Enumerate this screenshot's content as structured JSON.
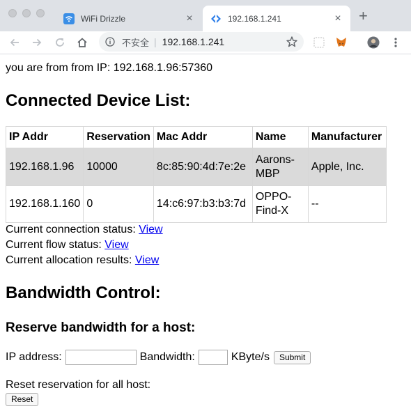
{
  "browser": {
    "tabs": [
      {
        "title": "WiFi Drizzle",
        "active": false
      },
      {
        "title": "192.168.1.241",
        "active": true
      }
    ],
    "address": {
      "security_label": "不安全",
      "separator": "|",
      "url": "192.168.1.241"
    },
    "colors": {
      "tabbar": "#dee1e6",
      "active_tab": "#ffffff",
      "link": "#0000ee"
    }
  },
  "page": {
    "client_ip_line": "you are from from IP: 192.168.1.96:57360",
    "connected_heading": "Connected Device List:",
    "table": {
      "headers": [
        "IP Addr",
        "Reservation",
        "Mac Addr",
        "Name",
        "Manufacturer"
      ],
      "rows": [
        {
          "ip": "192.168.1.96",
          "reservation": "10000",
          "mac": "8c:85:90:4d:7e:2e",
          "name_line1": "Aarons-",
          "name_line2": "MBP",
          "manufacturer": "Apple, Inc."
        },
        {
          "ip": "192.168.1.160",
          "reservation": "0",
          "mac": "14:c6:97:b3:b3:7d",
          "name_line1": "OPPO-",
          "name_line2": "Find-X",
          "manufacturer": "--"
        }
      ]
    },
    "status_links": [
      {
        "label": "Current connection status:",
        "link": "View"
      },
      {
        "label": "Current flow status:",
        "link": "View"
      },
      {
        "label": "Current allocation results:",
        "link": "View"
      }
    ],
    "bandwidth_heading": "Bandwidth Control:",
    "reserve_heading": "Reserve bandwidth for a host:",
    "form": {
      "ip_label": "IP address:",
      "ip_value": "",
      "bandwidth_label": "Bandwidth:",
      "bandwidth_value": "",
      "unit_label": "KByte/s",
      "submit_label": "Submit"
    },
    "reset": {
      "label": "Reset reservation for all host:",
      "button_label": "Reset"
    }
  }
}
